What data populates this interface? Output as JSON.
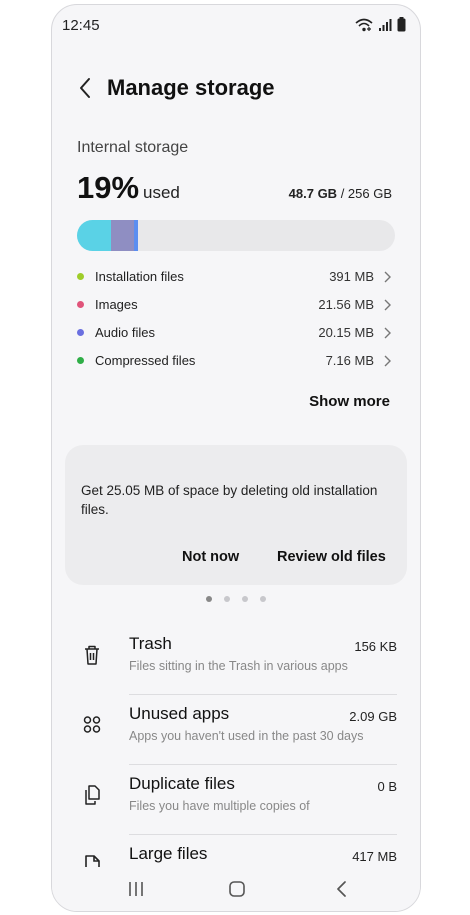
{
  "status_bar": {
    "time": "12:45",
    "icons": [
      "wifi-icon",
      "signal-icon",
      "battery-icon"
    ]
  },
  "header": {
    "title": "Manage storage",
    "back_icon": "chevron-left-icon"
  },
  "storage": {
    "section_label": "Internal storage",
    "percent": "19%",
    "used_label": "used",
    "used_amount": "48.7 GB",
    "total_suffix": " / 256 GB",
    "bar_segments": [
      {
        "name": "Installation files",
        "fraction": 0.106,
        "color": "#5ad2e6"
      },
      {
        "name": "Images",
        "fraction": 0.073,
        "color": "#8f8ec2"
      },
      {
        "name": "Audio files",
        "fraction": 0.012,
        "color": "#5b8ef0"
      }
    ]
  },
  "categories": [
    {
      "label": "Installation files",
      "size": "391 MB",
      "color": "#9fcd2a"
    },
    {
      "label": "Images",
      "size": "21.56 MB",
      "color": "#e0547a"
    },
    {
      "label": "Audio files",
      "size": "20.15 MB",
      "color": "#6a6fe0"
    },
    {
      "label": "Compressed files",
      "size": "7.16 MB",
      "color": "#2fae47"
    }
  ],
  "show_more_label": "Show more",
  "suggestion": {
    "text": "Get 25.05 MB of space by deleting old installation files.",
    "dismiss_label": "Not now",
    "action_label": "Review old files"
  },
  "pager": {
    "count": 4,
    "active": 0
  },
  "tools": [
    {
      "title": "Trash",
      "subtitle": "Files sitting in the Trash in various apps",
      "size": "156 KB",
      "icon": "trash-icon"
    },
    {
      "title": "Unused apps",
      "subtitle": "Apps you haven't used in the past 30 days",
      "size": "2.09 GB",
      "icon": "apps-grid-icon"
    },
    {
      "title": "Duplicate files",
      "subtitle": "Files you have multiple copies of",
      "size": "0 B",
      "icon": "duplicate-files-icon"
    },
    {
      "title": "Large files",
      "subtitle": "",
      "size": "417 MB",
      "icon": "large-file-icon"
    }
  ],
  "nav_bar": {
    "icons": [
      "recents-icon",
      "home-icon",
      "back-icon"
    ]
  }
}
